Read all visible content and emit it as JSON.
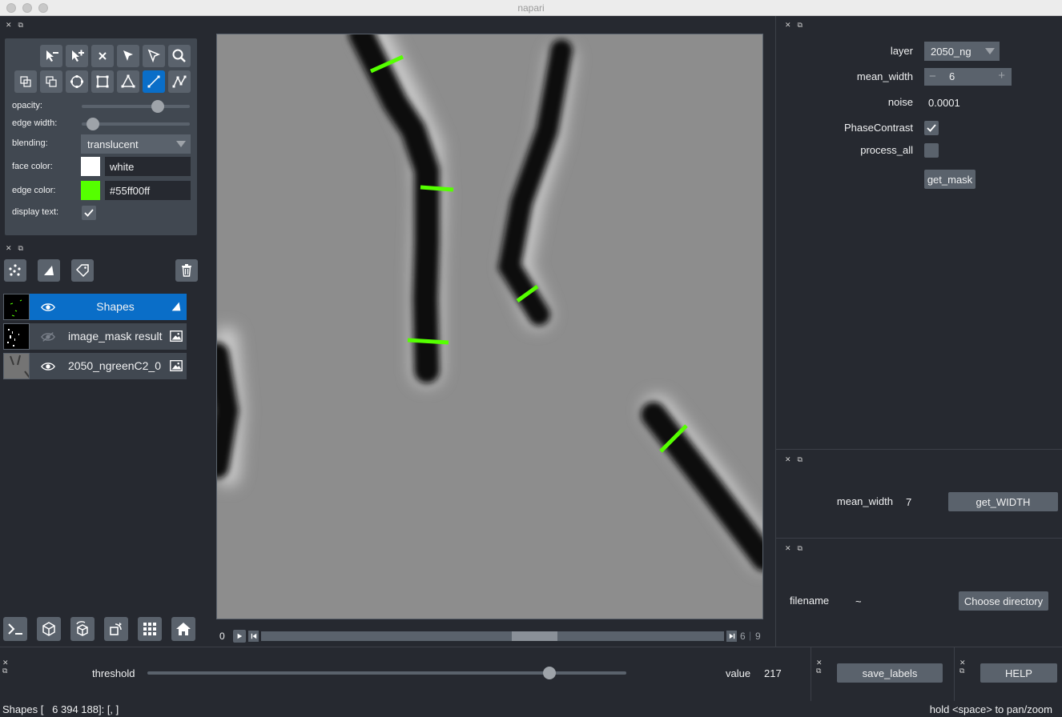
{
  "window": {
    "title": "napari"
  },
  "layer_controls": {
    "opacity": {
      "label": "opacity:",
      "value": 0.7
    },
    "edge_width": {
      "label": "edge width:",
      "value": 0.1
    },
    "blending": {
      "label": "blending:",
      "value": "translucent"
    },
    "face_color": {
      "label": "face color:",
      "value": "white",
      "swatch": "#ffffff"
    },
    "edge_color": {
      "label": "edge color:",
      "value": "#55ff00ff",
      "swatch": "#55ff00"
    },
    "display_text": {
      "label": "display text:",
      "checked": true
    },
    "tools": [
      "remove-vertex-icon",
      "add-vertex-icon",
      "delete-shape-icon",
      "select-icon",
      "direct-select-icon",
      "zoom-icon",
      "move-back-icon",
      "move-front-icon",
      "ellipse-icon",
      "rectangle-icon",
      "polygon-icon",
      "line-icon",
      "path-icon"
    ],
    "active_tool": "line-icon"
  },
  "layer_list": {
    "layers": [
      {
        "name": "Shapes",
        "visible": true,
        "selected": true,
        "kind": "shapes-icon"
      },
      {
        "name": "image_mask result",
        "visible": false,
        "selected": false,
        "kind": "image-icon"
      },
      {
        "name": "2050_ngreenC2_0",
        "visible": true,
        "selected": false,
        "kind": "image-icon"
      }
    ]
  },
  "dims": {
    "current": "0",
    "max_label": "6",
    "total_label": "9",
    "position": 0.6
  },
  "mask_widget": {
    "layer_label": "layer",
    "layer_value": "2050_ng",
    "mean_width_label": "mean_width",
    "mean_width_value": "6",
    "noise_label": "noise",
    "noise_value": "0.0001",
    "phase_label": "PhaseContrast",
    "phase_checked": true,
    "process_all_label": "process_all",
    "process_all_checked": false,
    "button": "get_mask"
  },
  "width_widget": {
    "mean_width_label": "mean_width",
    "mean_width_value": "7",
    "button": "get_WIDTH"
  },
  "file_widget": {
    "filename_label": "filename",
    "filename_value": "~",
    "button": "Choose directory"
  },
  "threshold_widget": {
    "label": "threshold",
    "value_label": "value",
    "value": "217",
    "position": 0.84
  },
  "save_widget": {
    "button": "save_labels"
  },
  "help_widget": {
    "button": "HELP"
  },
  "status": {
    "left": "Shapes [   6 394 188]: [, ]",
    "right": "hold <space> to pan/zoom"
  },
  "colors": {
    "accent": "#0a6ec8",
    "background": "#262930",
    "panel": "#414851",
    "edge": "#55ff00"
  }
}
